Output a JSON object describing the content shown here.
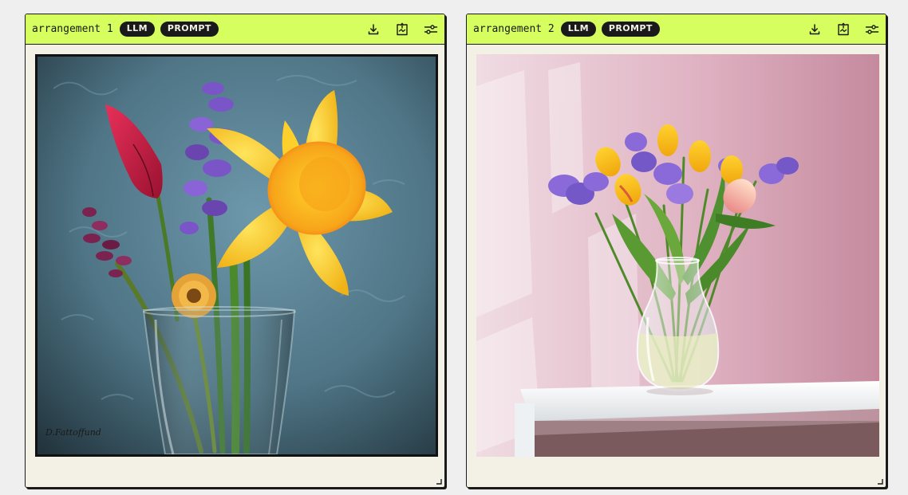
{
  "cards": [
    {
      "title": "arrangement 1",
      "badges": [
        "LLM",
        "PROMPT"
      ],
      "actions": [
        "download-icon",
        "share-icon",
        "sliders-icon"
      ],
      "image": {
        "subject": "daffodil, tulip, hyacinth and lavender in glass vase against blue textured wall",
        "signature": "D.Fattoffund"
      }
    },
    {
      "title": "arrangement 2",
      "badges": [
        "LLM",
        "PROMPT"
      ],
      "actions": [
        "download-icon",
        "share-icon",
        "sliders-icon"
      ],
      "image": {
        "subject": "yellow and pink tulips with purple hyacinths in glass vase on white shelf against pink wall"
      }
    }
  ],
  "colors": {
    "header_bg": "#d6fe5f",
    "card_bg": "#f3f0e5",
    "page_bg": "#efefef",
    "ink": "#1a1a1a"
  }
}
